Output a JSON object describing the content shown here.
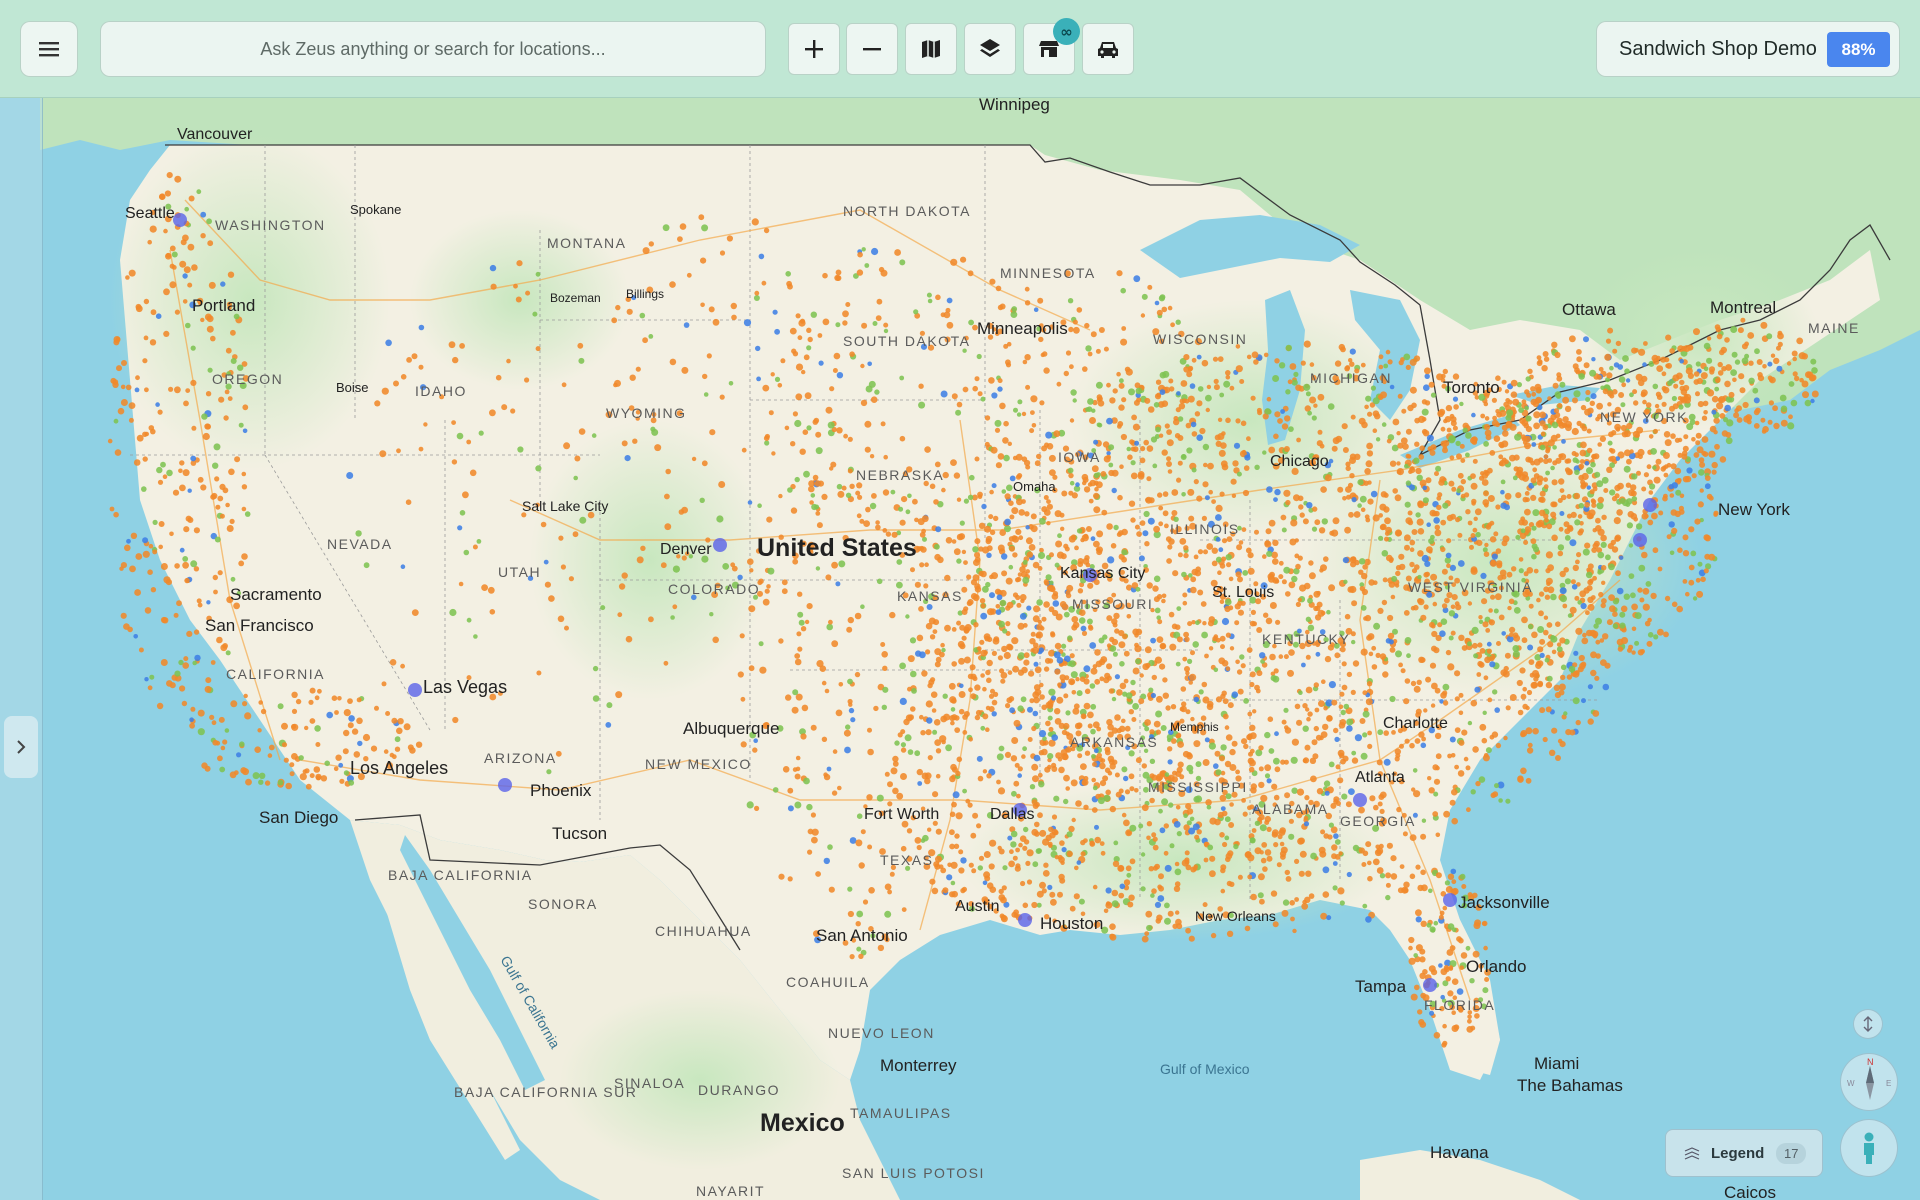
{
  "app": {
    "search_placeholder": "Ask Zeus anything or search for locations...",
    "project_name": "Sandwich Shop Demo",
    "project_percent": "88%",
    "infinity_badge": "∞",
    "legend_label": "Legend",
    "legend_count": "17"
  },
  "toolbar": {
    "icons": [
      "menu-icon",
      "plus-icon",
      "minus-icon",
      "map-icon",
      "layers-icon",
      "store-icon",
      "car-icon"
    ]
  },
  "map": {
    "labels": {
      "countries": [
        "United States",
        "Mexico"
      ],
      "states": [
        "WASHINGTON",
        "OREGON",
        "IDAHO",
        "MONTANA",
        "WYOMING",
        "NEVADA",
        "UTAH",
        "COLORADO",
        "CALIFORNIA",
        "ARIZONA",
        "NEW MEXICO",
        "TEXAS",
        "KANSAS",
        "NEBRASKA",
        "IOWA",
        "ILLINOIS",
        "MISSOURI",
        "MINNESOTA",
        "WISCONSIN",
        "MICHIGAN",
        "NORTH DAKOTA",
        "SOUTH DAKOTA",
        "KENTUCKY",
        "ARKANSAS",
        "MISSISSIPPI",
        "ALABAMA",
        "GEORGIA",
        "FLORIDA",
        "WEST VIRGINIA",
        "NEW YORK",
        "MAINE",
        "BAJA CALIFORNIA",
        "SONORA",
        "CHIHUAHUA",
        "COAHUILA",
        "NUEVO LEON",
        "BAJA CALIFORNIA SUR",
        "SINALOA",
        "DURANGO",
        "TAMAULIPAS",
        "NAYARIT",
        "SAN LUIS POTOSI"
      ],
      "cities": [
        "Vancouver",
        "Seattle",
        "Spokane",
        "Portland",
        "Boise",
        "Bozeman",
        "Billings",
        "Winnipeg",
        "Minneapolis",
        "Salt Lake City",
        "Denver",
        "Omaha",
        "Sacramento",
        "San Francisco",
        "Las Vegas",
        "Albuquerque",
        "Los Angeles",
        "San Diego",
        "Phoenix",
        "Tucson",
        "Kansas City",
        "St. Louis",
        "Chicago",
        "Memphis",
        "Dallas",
        "Fort Worth",
        "Austin",
        "San Antonio",
        "Houston",
        "New Orleans",
        "Atlanta",
        "Charlotte",
        "Jacksonville",
        "Orlando",
        "Tampa",
        "Miami",
        "Monterrey",
        "Toronto",
        "Ottawa",
        "Montreal",
        "New York",
        "Havana",
        "The Bahamas",
        "Caicos"
      ],
      "water": [
        "Gulf of Mexico",
        "Gulf of California"
      ]
    }
  },
  "colors": {
    "toolbar_bg": "#c4e8d3",
    "accent": "#4a86ee",
    "badge": "#3ab0b9",
    "dot_orange": "#f0892a",
    "dot_green": "#7ec352",
    "dot_blue": "#3f7fe5",
    "land": "#f3f0e6",
    "forest": "#bfe2b4",
    "water": "#8fd1e4"
  }
}
